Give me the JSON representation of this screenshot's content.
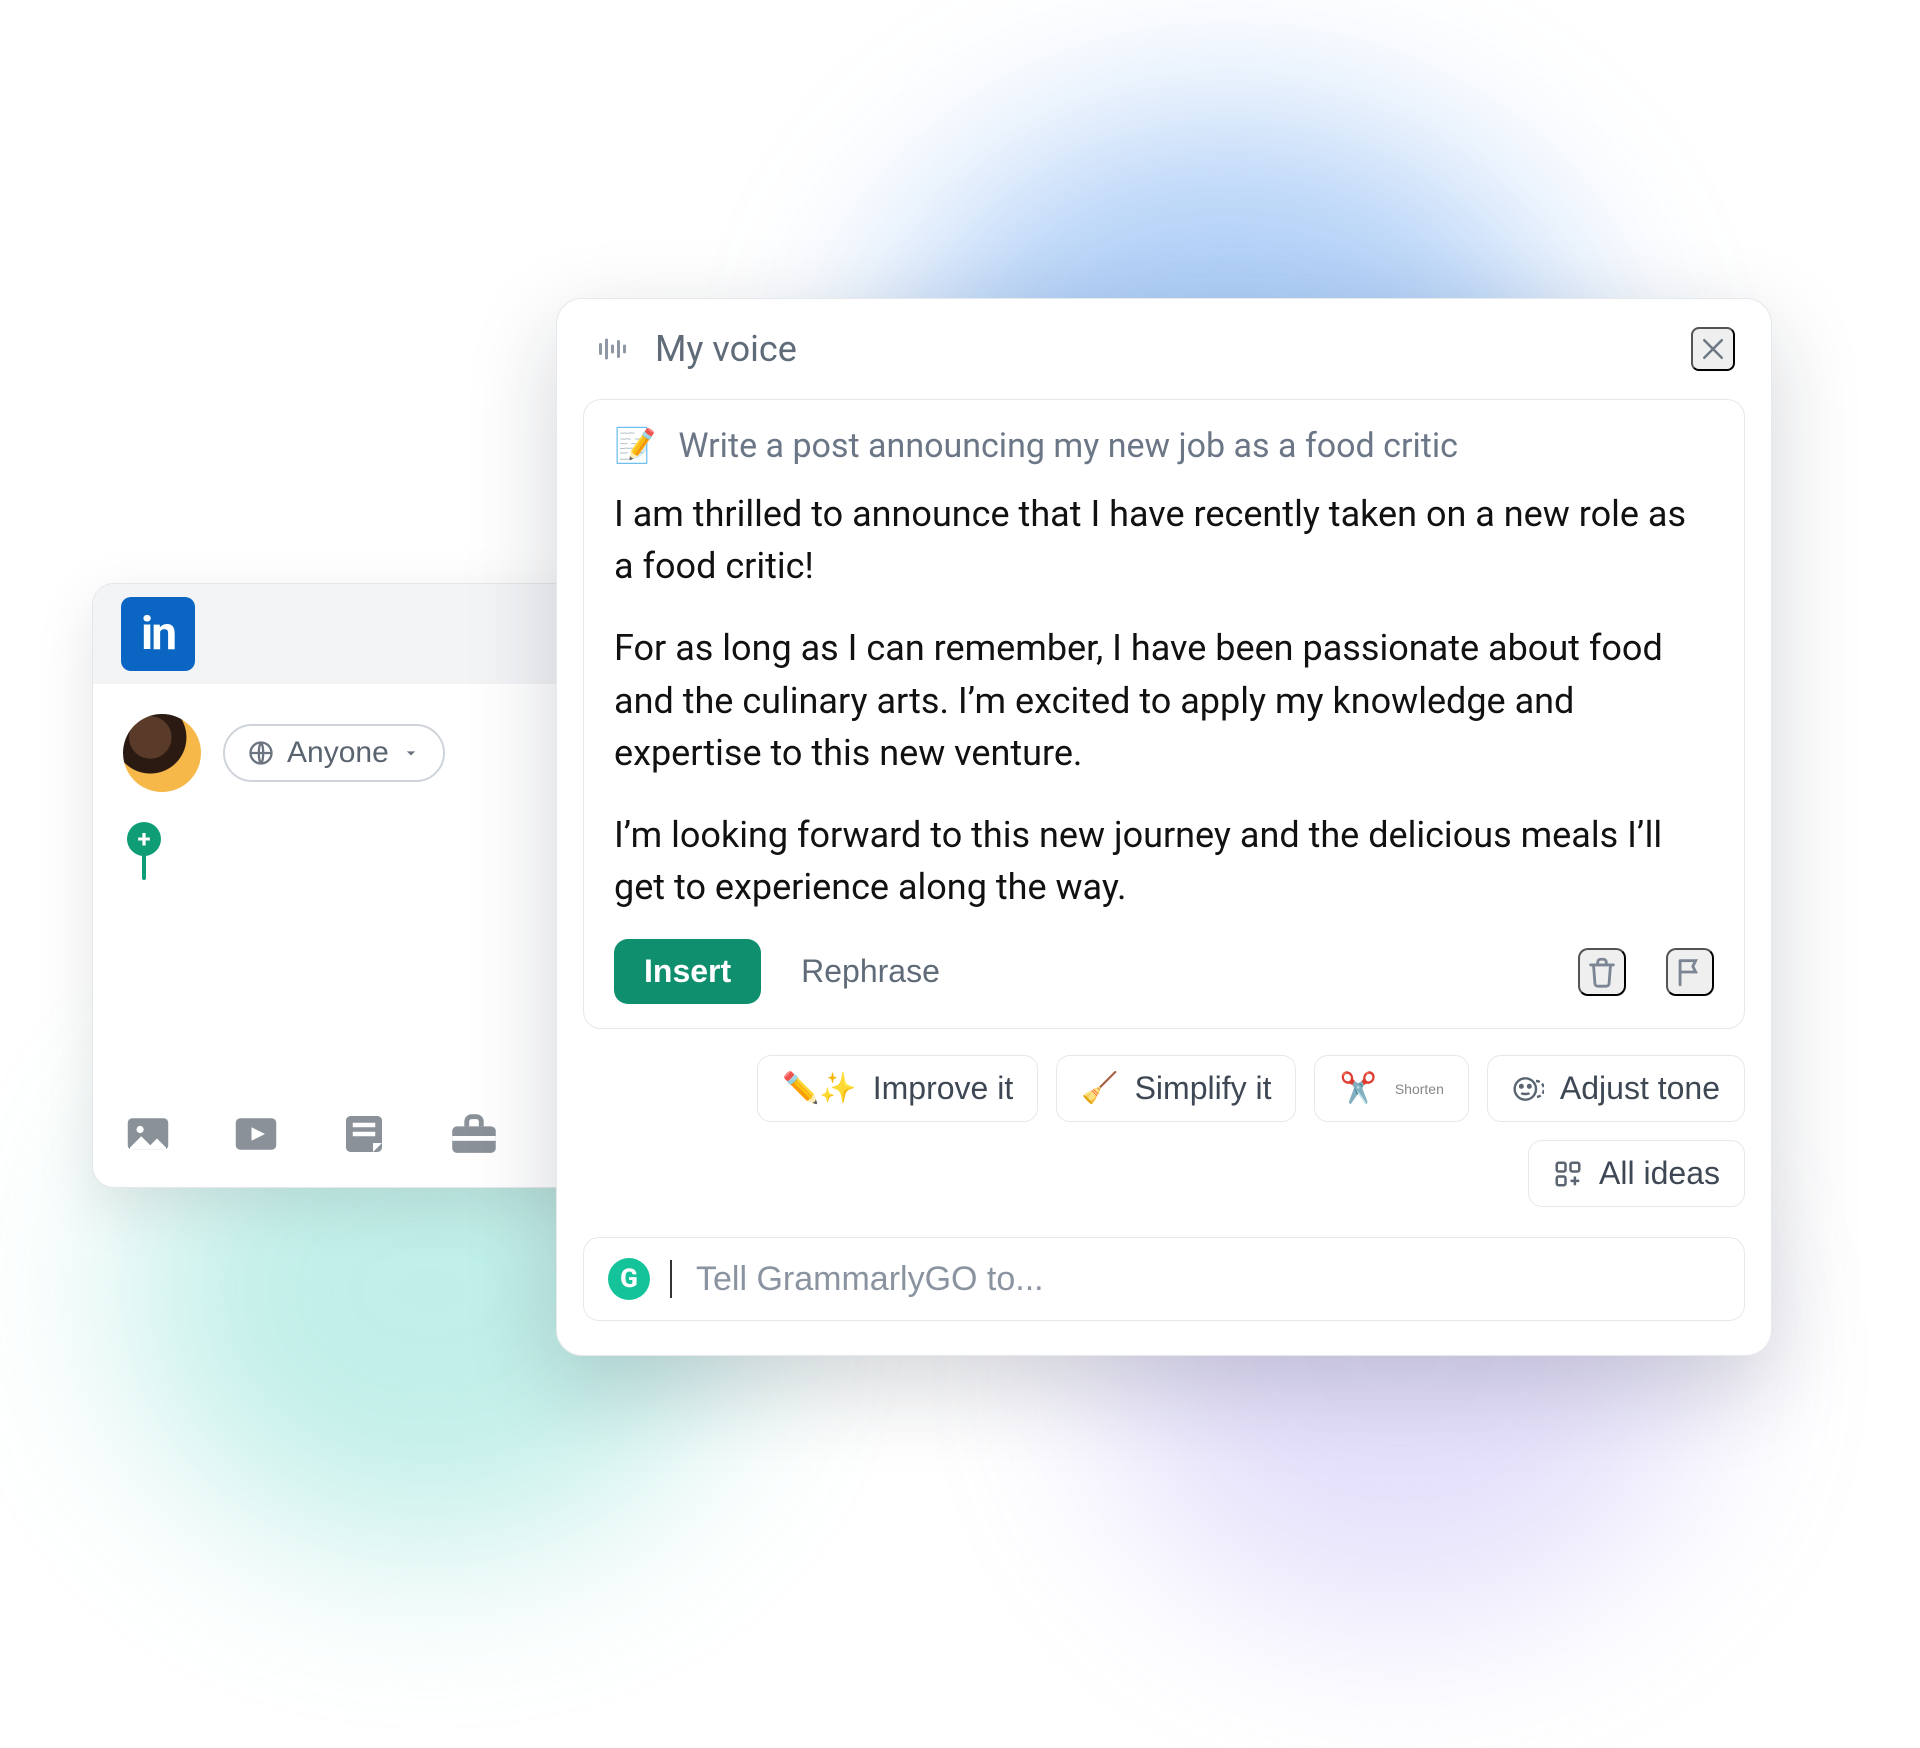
{
  "linkedin": {
    "logo_text": "in",
    "audience_label": "Anyone"
  },
  "grammarly": {
    "header_title": "My voice",
    "prompt": "Write a post announcing my new job as a food critic",
    "paragraphs": [
      "I am thrilled to announce that I have recently taken on a new role as a food critic!",
      "For as long as I can remember, I have been passionate about food and the culinary arts. I’m excited to apply my knowledge and expertise to this new venture.",
      "I’m looking forward to this new journey and the delicious meals I’ll get to experience along the way."
    ],
    "insert_label": "Insert",
    "rephrase_label": "Rephrase",
    "chips": {
      "improve": "Improve it",
      "simplify": "Simplify it",
      "shorten": "Shorten",
      "adjust_tone": "Adjust tone",
      "all_ideas": "All ideas"
    },
    "input_placeholder": "Tell GrammarlyGO to...",
    "brand_initial": "G"
  }
}
